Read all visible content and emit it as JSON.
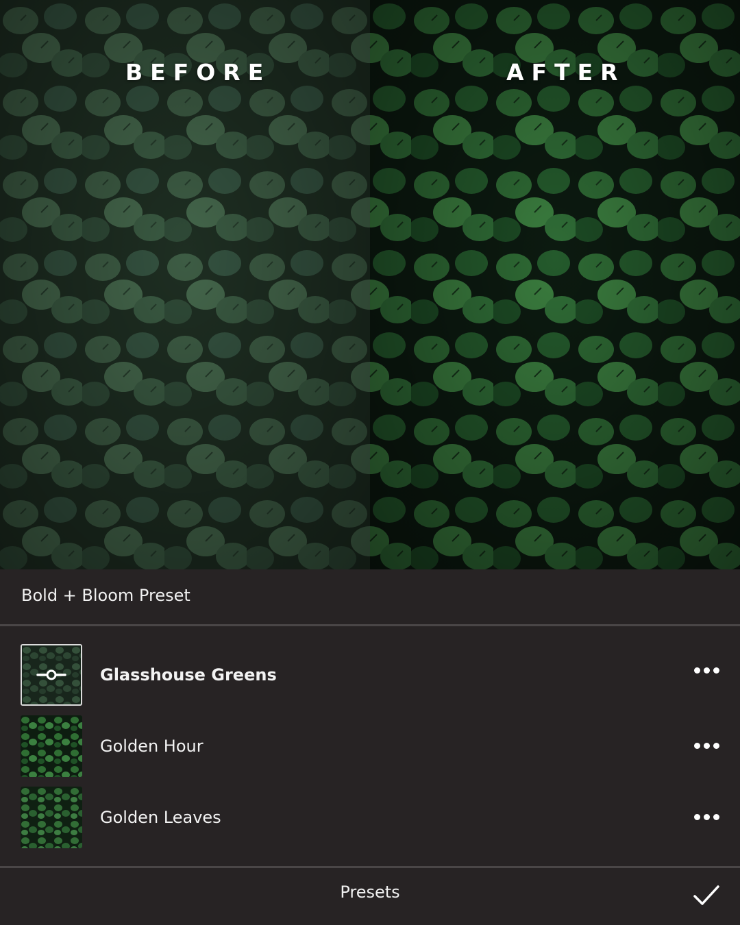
{
  "preview": {
    "before_label": "BEFORE",
    "after_label": "AFTER"
  },
  "panel": {
    "title": "Bold + Bloom Preset"
  },
  "presets": [
    {
      "name": "Glasshouse Greens",
      "selected": true,
      "icon": "sliders-icon"
    },
    {
      "name": "Golden Hour",
      "selected": false
    },
    {
      "name": "Golden Leaves",
      "selected": false
    }
  ],
  "footer": {
    "label": "Presets",
    "confirm_icon": "checkmark-icon"
  },
  "colors": {
    "panel_bg": "#272324",
    "divider": "#4a4647",
    "text": "#ffffff"
  }
}
